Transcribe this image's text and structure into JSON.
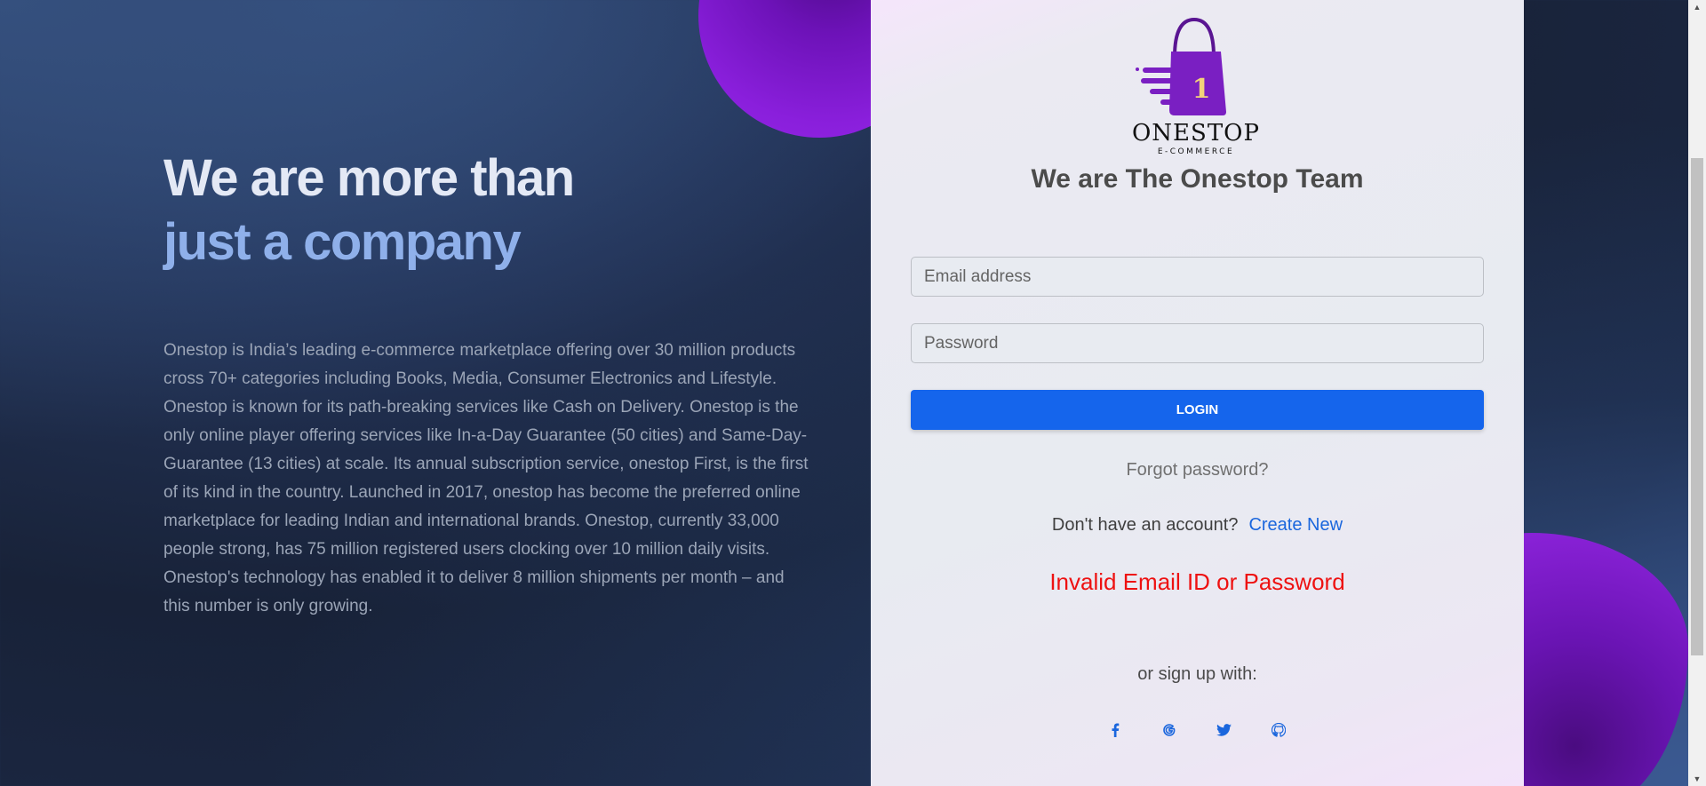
{
  "hero": {
    "title_line1": "We are more than",
    "title_line2": "just a company",
    "description": "Onestop is India’s leading e-commerce marketplace offering over 30 million products cross 70+ categories including Books, Media, Consumer Electronics and Lifestyle. Onestop is known for its path-breaking services like Cash on Delivery. Onestop is the only online player offering services like In-a-Day Guarantee (50 cities) and Same-Day-Guarantee (13 cities) at scale. Its annual subscription service, onestop First, is the first of its kind in the country. Launched in 2017, onestop has become the preferred online marketplace for leading Indian and international brands. Onestop, currently 33,000 people strong, has 75 million registered users clocking over 10 million daily visits. Onestop's technology has enabled it to deliver 8 million shipments per month – and this number is only growing."
  },
  "logo": {
    "badge": "1",
    "brand": "ONESTOP",
    "tagline": "E-COMMERCE"
  },
  "login": {
    "heading": "We are The Onestop Team",
    "email_placeholder": "Email address",
    "email_value": "",
    "password_placeholder": "Password",
    "password_value": "",
    "login_label": "LOGIN",
    "forgot_label": "Forgot password?",
    "no_account_text": "Don't have an account?",
    "create_label": "Create New",
    "error_text": "Invalid Email ID or Password",
    "signup_with_label": "or sign up with:"
  },
  "social": [
    {
      "icon": "facebook-icon"
    },
    {
      "icon": "google-icon"
    },
    {
      "icon": "twitter-icon"
    },
    {
      "icon": "github-icon"
    }
  ],
  "colors": {
    "accent": "#1565ec",
    "error": "#ee1111",
    "brand_purple": "#7a1fc2"
  }
}
